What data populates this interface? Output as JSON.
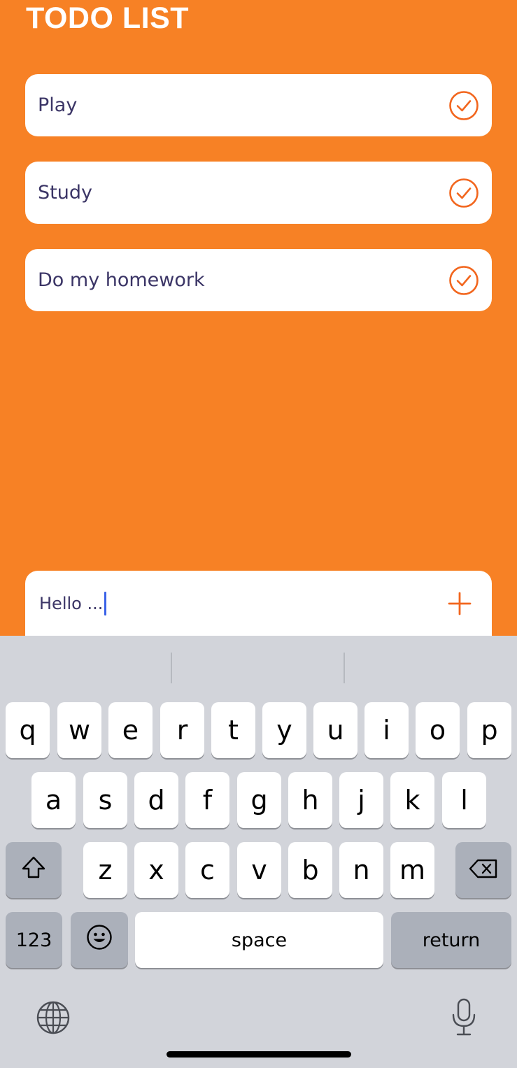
{
  "header": {
    "title": "TODO LIST"
  },
  "todos": [
    {
      "text": "Play",
      "icon": "check-circle-icon"
    },
    {
      "text": "Study",
      "icon": "check-circle-icon"
    },
    {
      "text": "Do my homework",
      "icon": "check-circle-icon"
    }
  ],
  "input": {
    "value": "Hello ...",
    "add_icon": "plus-icon"
  },
  "keyboard": {
    "row1": [
      "q",
      "w",
      "e",
      "r",
      "t",
      "y",
      "u",
      "i",
      "o",
      "p"
    ],
    "row2": [
      "a",
      "s",
      "d",
      "f",
      "g",
      "h",
      "j",
      "k",
      "l"
    ],
    "row3": [
      "z",
      "x",
      "c",
      "v",
      "b",
      "n",
      "m"
    ],
    "numbers_label": "123",
    "space_label": "space",
    "return_label": "return"
  },
  "colors": {
    "accent": "#F78125",
    "text": "#3B3566",
    "caret": "#3A62E8"
  }
}
